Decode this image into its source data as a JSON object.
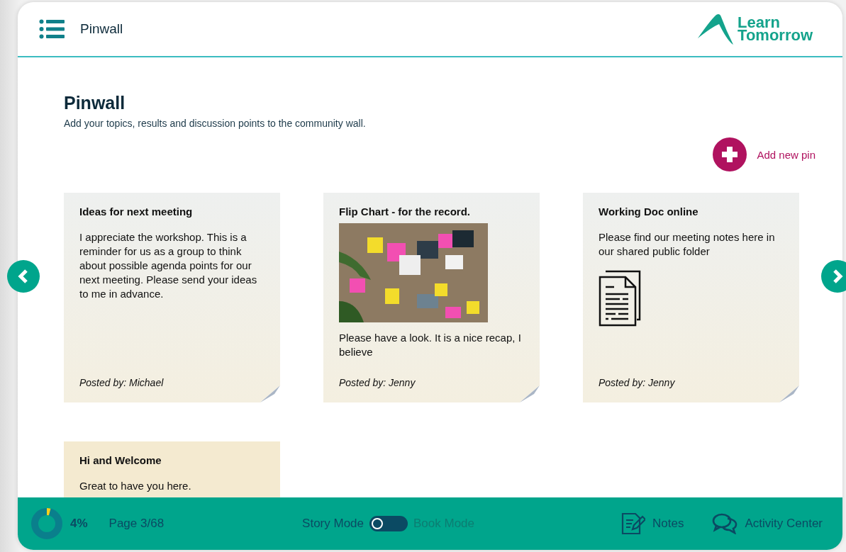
{
  "header": {
    "title": "Pinwall",
    "logo": {
      "line1": "Learn",
      "line2": "Tomorrow"
    }
  },
  "page": {
    "heading": "Pinwall",
    "description": "Add your topics, results and discussion points to the community wall.",
    "add_button": "Add new pin"
  },
  "pins": [
    {
      "kind": "text",
      "title": "Ideas for next meeting",
      "body": "I appreciate the workshop. This is a reminder for us as a group to think about possible agenda points for our next meeting. Please send your ideas to me in advance.",
      "author": "Posted by: Michael"
    },
    {
      "title": "Flip Chart - for the record.",
      "body": "Please have a look. It is a nice recap, I believe",
      "author": "Posted by: Jenny"
    },
    {
      "kind": "document",
      "title": "Working Doc online",
      "body": "Please find our meeting notes here in our shared public folder",
      "author": "Posted by: Jenny"
    },
    {
      "kind": "text",
      "title": "Hi and Welcome",
      "body": "Great to have you here."
    }
  ],
  "footer": {
    "progress": {
      "level": 0.04,
      "label": "4%"
    },
    "page": "Page 3/68",
    "mode_switch": {
      "on": false
    },
    "modes": [
      {
        "label": "Story Mode",
        "selected": true
      },
      {
        "label": "Book Mode",
        "selected": false
      }
    ],
    "notes": "Notes",
    "activity": "Activity Center"
  }
}
